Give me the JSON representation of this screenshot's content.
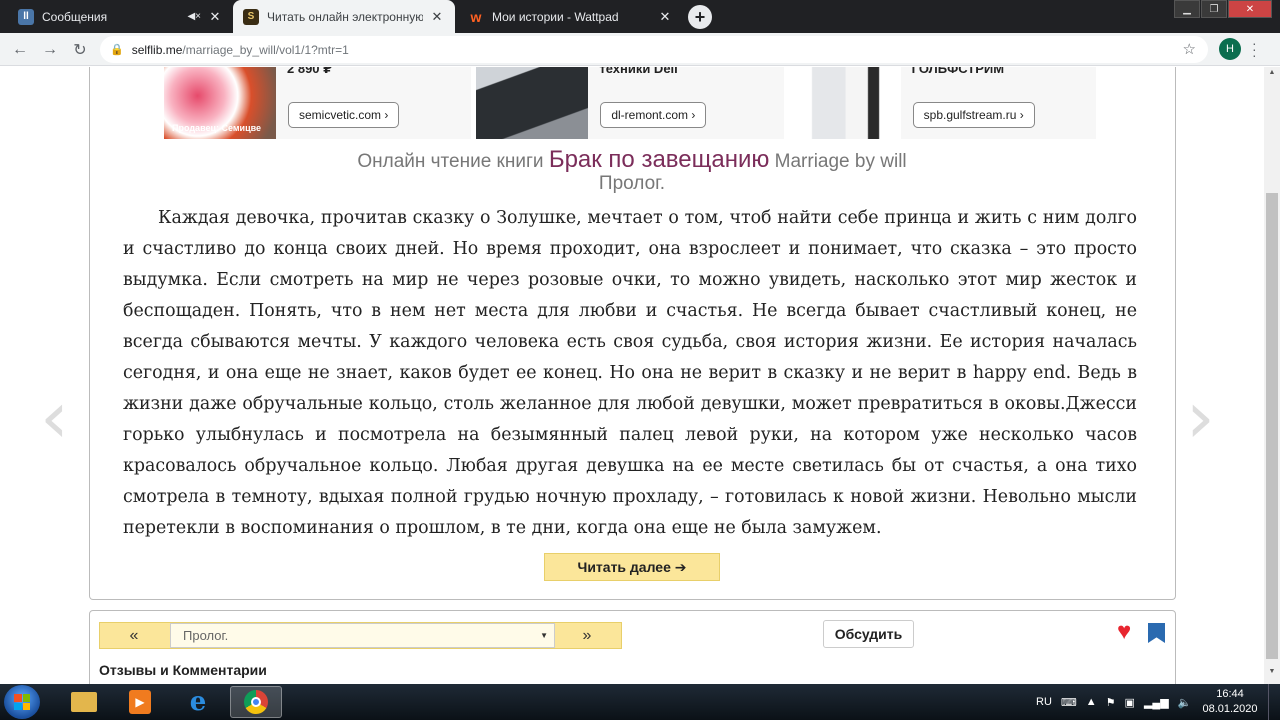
{
  "browser": {
    "tabs": [
      {
        "title": "Сообщения",
        "favicon": "vk-icon",
        "favicon_color": "#4a76a8",
        "muted": true
      },
      {
        "title": "Читать онлайн электронную кн",
        "favicon": "selflib-icon",
        "favicon_color": "#3a2d14",
        "active": true
      },
      {
        "title": "Мои истории - Wattpad",
        "favicon": "wattpad-icon",
        "favicon_color": "#ff6122"
      }
    ],
    "url_host": "selflib.me",
    "url_path": "/marriage_by_will/vol1/1?mtr=1",
    "profile_initial": "H"
  },
  "ads": [
    {
      "heading": "2 890 ₽",
      "domain": "semicvetic.com ›",
      "seller": "Продавец: Семицве"
    },
    {
      "heading": "техники Dell",
      "domain": "dl-remont.com ›"
    },
    {
      "heading": "ГОЛЬФСТРИМ",
      "domain": "spb.gulfstream.ru ›"
    }
  ],
  "book": {
    "prefix": "Онлайн чтение книги",
    "title": "Брак по завещанию",
    "original_title": "Marriage by will",
    "chapter": "Пролог."
  },
  "text": "Каждая девочка, прочитав сказку о Золушке, мечтает о том, чтоб найти себе принца и жить с ним долго и счастливо до конца своих дней. Но время проходит, она взрослеет и понимает, что сказка – это просто выдумка. Если смотреть на мир не через розовые очки, то можно увидеть, насколько этот мир жесток и беспощаден. Понять, что в нем нет места для любви и счастья. Не всегда бывает счастливый конец, не всегда сбываются мечты. У каждого человека есть своя судьба, своя история жизни. Ее история началась сегодня, и она еще не знает, каков будет ее конец. Но она не верит в сказку и не верит в happy end. Ведь в жизни даже обручальные кольцо, столь желанное для любой девушки, может превратиться в оковы.Джесси горько улыбнулась и посмотрела на безымянный палец левой руки, на котором уже несколько часов красовалось обручальное кольцо. Любая другая девушка на ее месте светилась бы от счастья, а она тихо смотрела в темноту, вдыхая полной грудью ночную прохладу, – готовилась к новой жизни. Невольно мысли перетекли в воспоминания о прошлом, в те дни, когда она еще не была замужем.",
  "buttons": {
    "read_more": "Читать далее ➔",
    "prev": "«",
    "next": "»",
    "chapter_select": "Пролог.",
    "discuss": "Обсудить"
  },
  "reviews_label": "Отзывы и Комментарии",
  "colors": {
    "accent_title": "#7b2d5a",
    "button_yellow": "#fbe69a",
    "heart": "#e8252f",
    "bookmark": "#2a6ab0"
  },
  "taskbar": {
    "language": "RU",
    "time": "16:44",
    "date": "08.01.2020"
  }
}
